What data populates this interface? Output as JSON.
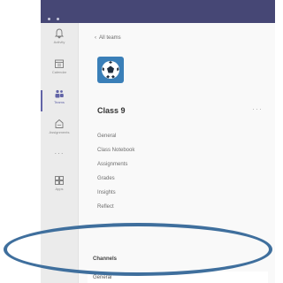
{
  "app": {
    "topbar_color": "#464775",
    "accent": "#6264a7"
  },
  "rail": {
    "items": [
      {
        "label": "Activity",
        "icon": "bell-icon"
      },
      {
        "label": "Calendar",
        "icon": "calendar-icon"
      },
      {
        "label": "Teams",
        "icon": "teams-icon",
        "active": true
      },
      {
        "label": "Assignments",
        "icon": "assignments-icon"
      },
      {
        "label": "",
        "icon": "more-apps-icon"
      },
      {
        "label": "Apps",
        "icon": "apps-icon"
      }
    ]
  },
  "team": {
    "back_label": "All teams",
    "name": "Class 9",
    "more": "···",
    "logo_color": "#3a7fb8"
  },
  "channels": [
    "General",
    "Class Notebook",
    "Assignments",
    "Grades",
    "Insights",
    "Reflect"
  ],
  "hidden": {
    "heading": "Channels",
    "item": "General"
  },
  "highlight_color": "#3f6f9d"
}
